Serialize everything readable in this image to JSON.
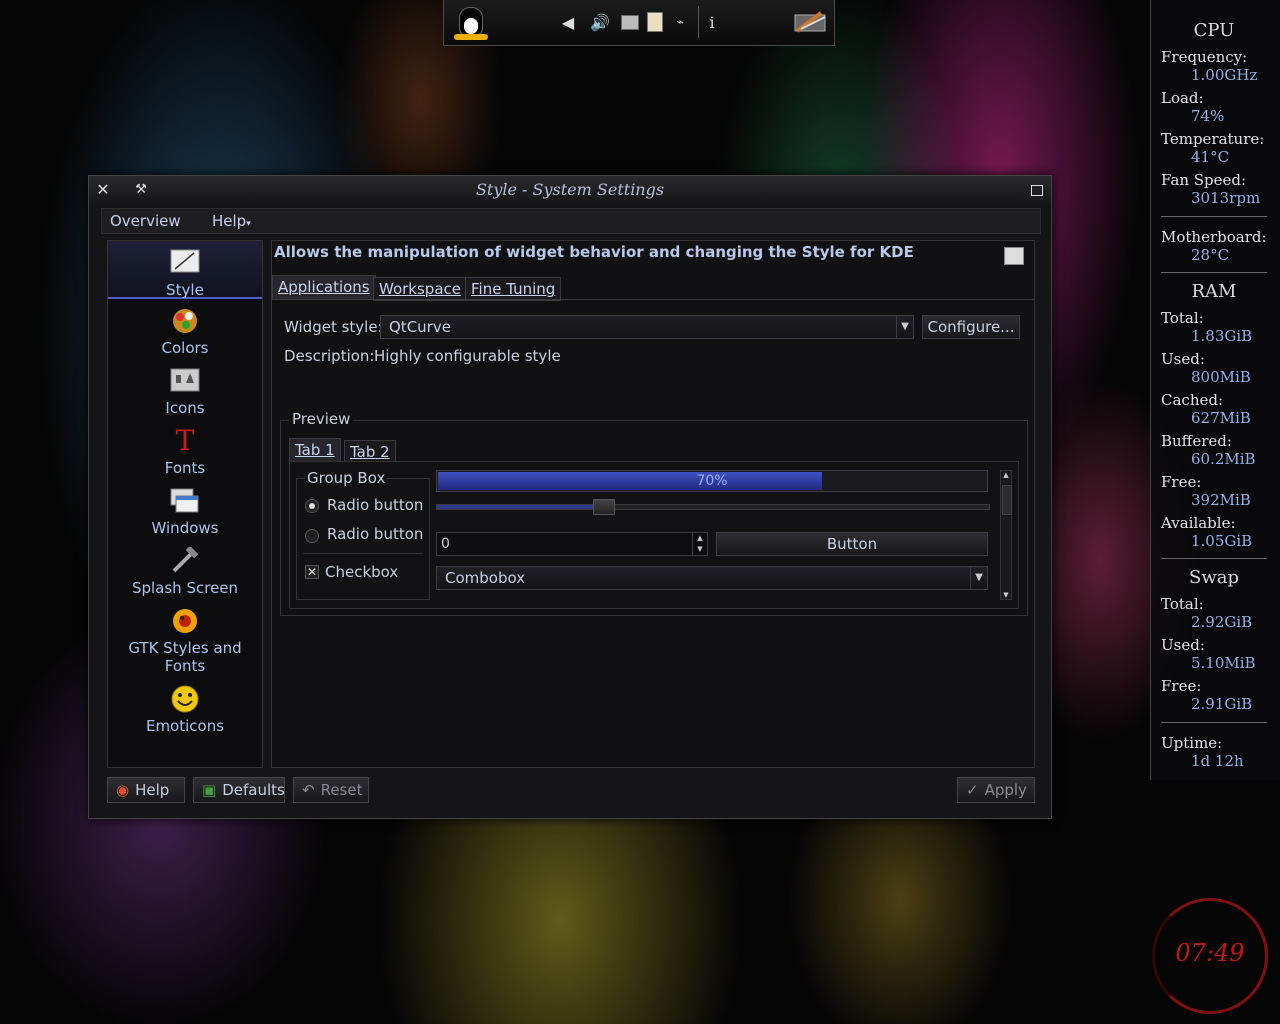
{
  "window": {
    "title": "Style - System Settings",
    "menu": [
      "Overview",
      "Help"
    ]
  },
  "sidebar": {
    "items": [
      {
        "label": "Style",
        "icon": "style-icon",
        "active": true
      },
      {
        "label": "Colors",
        "icon": "colors-icon"
      },
      {
        "label": "Icons",
        "icon": "icons-icon"
      },
      {
        "label": "Fonts",
        "icon": "fonts-icon"
      },
      {
        "label": "Windows",
        "icon": "windows-icon"
      },
      {
        "label": "Splash Screen",
        "icon": "splash-screen-icon"
      },
      {
        "label": "GTK Styles and Fonts",
        "icon": "gtk-icon"
      },
      {
        "label": "Emoticons",
        "icon": "emoticons-icon"
      }
    ]
  },
  "content": {
    "header": "Allows the manipulation of widget behavior and changing the Style for KDE",
    "tabs": [
      "Applications",
      "Workspace",
      "Fine Tuning"
    ],
    "widget_style_label": "Widget style:",
    "widget_style_value": "QtCurve",
    "configure_label": "Configure...",
    "description_label": "Description:",
    "description_value": "Highly configurable style",
    "preview": {
      "title": "Preview",
      "tabs": [
        "Tab 1",
        "Tab 2"
      ],
      "group_box_title": "Group Box",
      "radio1": "Radio button",
      "radio2": "Radio button",
      "checkbox": "Checkbox",
      "progress_text": "70%",
      "progress_value": 0.7,
      "slider_value": 0.3,
      "spin_value": "0",
      "button": "Button",
      "combobox": "Combobox"
    }
  },
  "buttons": {
    "help": "Help",
    "defaults": "Defaults",
    "reset": "Reset",
    "apply": "Apply"
  },
  "sysmon": {
    "cpu_title": "CPU",
    "frequency_label": "Frequency:",
    "frequency": "1.00GHz",
    "load_label": "Load:",
    "load": "74%",
    "temperature_label": "Temperature:",
    "temperature": "41°C",
    "fan_label": "Fan Speed:",
    "fan": "3013rpm",
    "motherboard_label": "Motherboard:",
    "motherboard": "28°C",
    "ram_title": "RAM",
    "ram_total_label": "Total:",
    "ram_total": "1.83GiB",
    "ram_used_label": "Used:",
    "ram_used": "800MiB",
    "ram_cached_label": "Cached:",
    "ram_cached": "627MiB",
    "ram_buffered_label": "Buffered:",
    "ram_buffered": "60.2MiB",
    "ram_free_label": "Free:",
    "ram_free": "392MiB",
    "ram_available_label": "Available:",
    "ram_available": "1.05GiB",
    "swap_title": "Swap",
    "swap_total_label": "Total:",
    "swap_total": "2.92GiB",
    "swap_used_label": "Used:",
    "swap_used": "5.10MiB",
    "swap_free_label": "Free:",
    "swap_free": "2.91GiB",
    "uptime_label": "Uptime:",
    "uptime": "1d 12h"
  },
  "clock": {
    "time": "07:49"
  },
  "colors": {
    "accent": "#4050c0",
    "clock": "#c01818",
    "sysmon_value": "#90b0e8"
  }
}
